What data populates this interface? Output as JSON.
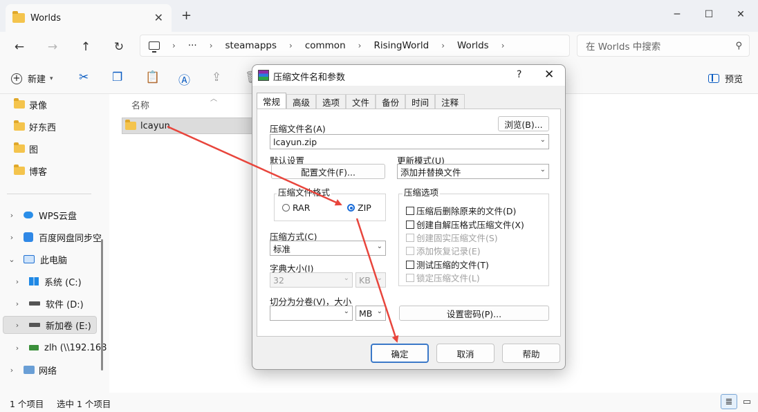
{
  "window": {
    "tab_title": "Worlds",
    "close_tab_glyph": "✕",
    "new_tab_glyph": "+",
    "minimize_glyph": "─",
    "maximize_glyph": "☐",
    "close_glyph": "✕"
  },
  "address": {
    "more": "···",
    "separator": "›",
    "crumbs": [
      "steamapps",
      "common",
      "RisingWorld",
      "Worlds"
    ],
    "search_placeholder": "在 Worlds 中搜索"
  },
  "toolbar": {
    "new_label": "新建",
    "preview_label": "预览"
  },
  "sidebar": {
    "items": [
      {
        "label": "录像"
      },
      {
        "label": "好东西"
      },
      {
        "label": "图"
      },
      {
        "label": "博客"
      },
      {
        "label": "WPS云盘"
      },
      {
        "label": "百度网盘同步空"
      },
      {
        "label": "此电脑"
      },
      {
        "label": "系统 (C:)"
      },
      {
        "label": "软件 (D:)"
      },
      {
        "label": "新加卷 (E:)"
      },
      {
        "label": "zlh (\\\\192.168"
      },
      {
        "label": "网络"
      }
    ]
  },
  "content": {
    "column_name": "名称",
    "files": [
      {
        "name": "lcayun"
      }
    ]
  },
  "status": {
    "count": "1 个项目",
    "selected": "选中 1 个项目"
  },
  "dialog": {
    "title": "压缩文件名和参数",
    "help": "?",
    "tabs": [
      "常规",
      "高级",
      "选项",
      "文件",
      "备份",
      "时间",
      "注释"
    ],
    "archive_name_label": "压缩文件名(A)",
    "browse_button": "浏览(B)...",
    "archive_name_value": "lcayun.zip",
    "default_settings_label": "默认设置",
    "profiles_button": "配置文件(F)...",
    "update_mode_label": "更新模式(U)",
    "update_mode_value": "添加并替换文件",
    "format_group_label": "压缩文件格式",
    "format_rar": "RAR",
    "format_zip": "ZIP",
    "method_label": "压缩方式(C)",
    "method_value": "标准",
    "dict_label": "字典大小(I)",
    "dict_value": "32",
    "dict_unit": "KB",
    "split_label": "切分为分卷(V)，大小",
    "split_value": "",
    "split_unit": "MB",
    "password_button": "设置密码(P)...",
    "options_group_label": "压缩选项",
    "options": [
      {
        "label": "压缩后删除原来的文件(D)",
        "enabled": true
      },
      {
        "label": "创建自解压格式压缩文件(X)",
        "enabled": true
      },
      {
        "label": "创建固实压缩文件(S)",
        "enabled": false
      },
      {
        "label": "添加恢复记录(E)",
        "enabled": false
      },
      {
        "label": "测试压缩的文件(T)",
        "enabled": true
      },
      {
        "label": "锁定压缩文件(L)",
        "enabled": false
      }
    ],
    "ok_button": "确定",
    "cancel_button": "取消",
    "help_button": "帮助"
  },
  "colors": {
    "annotation_arrow": "#e8453c",
    "accent": "#1a6cd8"
  }
}
